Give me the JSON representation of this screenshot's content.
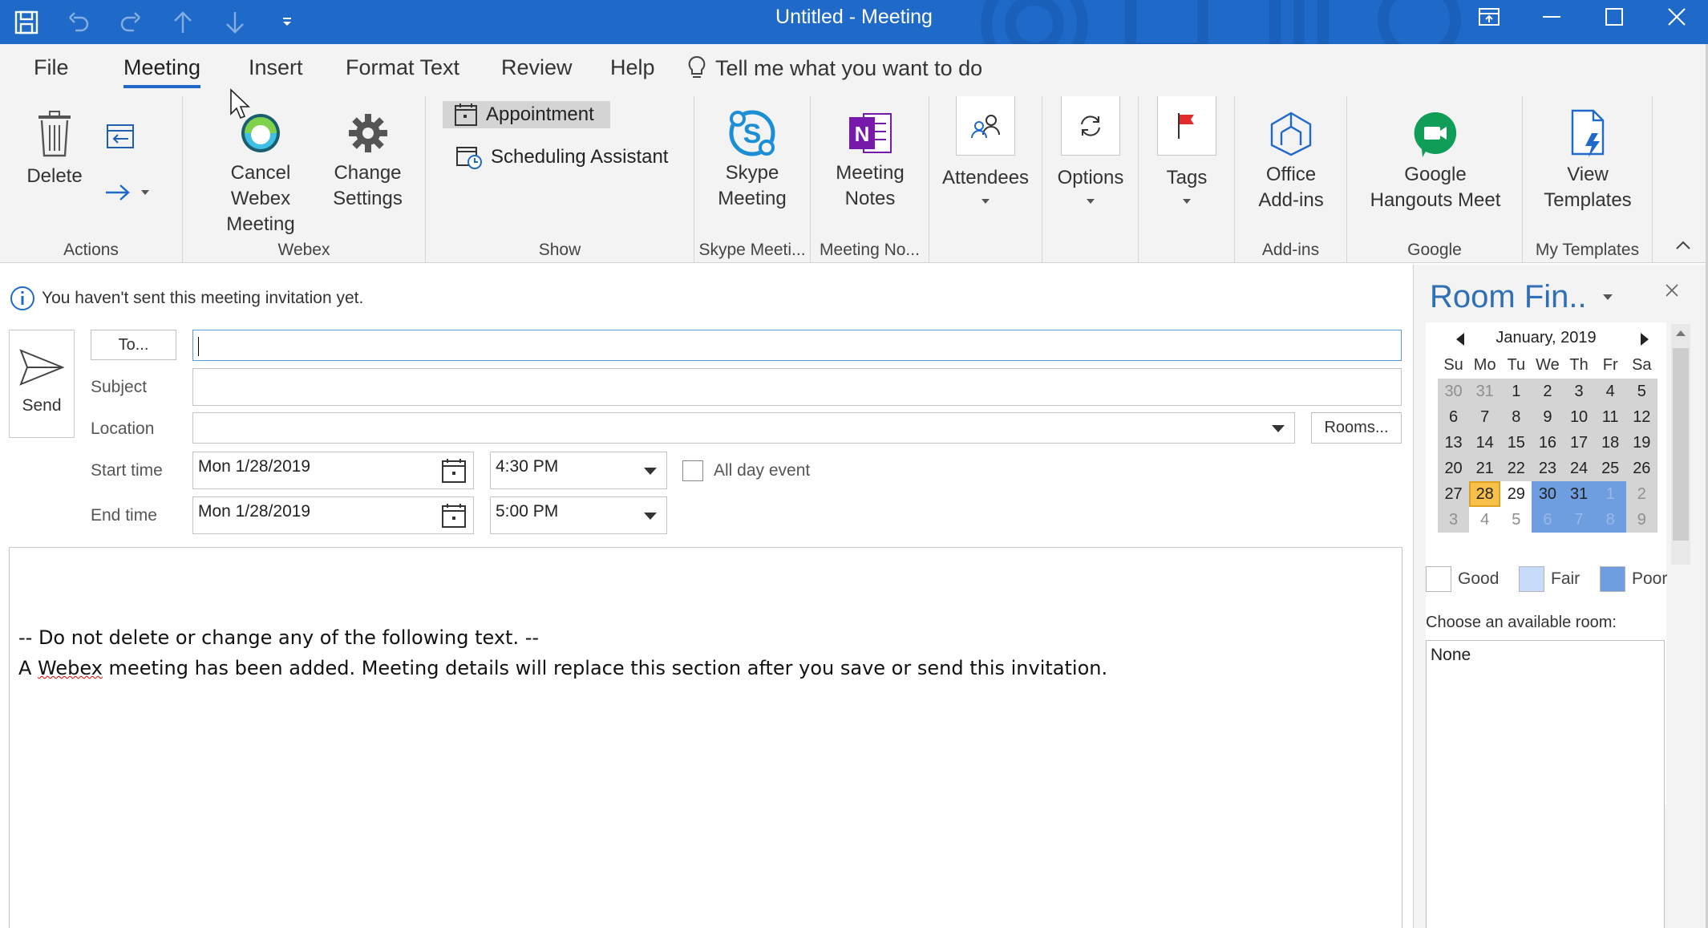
{
  "window": {
    "title": "Untitled  -  Meeting"
  },
  "tabs": [
    {
      "label": "File"
    },
    {
      "label": "Meeting"
    },
    {
      "label": "Insert"
    },
    {
      "label": "Format Text"
    },
    {
      "label": "Review"
    },
    {
      "label": "Help"
    }
  ],
  "tell_me": "Tell me what you want to do",
  "ribbon": {
    "actions": {
      "delete": "Delete",
      "group": "Actions"
    },
    "webex": {
      "cancel_line1": "Cancel Webex",
      "cancel_line2": "Meeting",
      "change_line1": "Change",
      "change_line2": "Settings",
      "group": "Webex"
    },
    "show": {
      "appointment": "Appointment",
      "scheduling": "Scheduling Assistant",
      "group": "Show"
    },
    "skype": {
      "line1": "Skype",
      "line2": "Meeting",
      "group": "Skype Meeti..."
    },
    "notes": {
      "line1": "Meeting",
      "line2": "Notes",
      "group": "Meeting No..."
    },
    "attendees": "Attendees",
    "options": "Options",
    "tags": "Tags",
    "addins": {
      "line1": "Office",
      "line2": "Add-ins",
      "group": "Add-ins"
    },
    "google": {
      "line1": "Google",
      "line2": "Hangouts Meet",
      "group": "Google"
    },
    "templates": {
      "line1": "View",
      "line2": "Templates",
      "group": "My Templates"
    }
  },
  "form": {
    "info": "You haven't sent this meeting invitation yet.",
    "send": "Send",
    "to_button": "To...",
    "subject_label": "Subject",
    "location_label": "Location",
    "rooms_button": "Rooms...",
    "start_label": "Start time",
    "end_label": "End time",
    "start_date": "Mon 1/28/2019",
    "start_time": "4:30 PM",
    "end_date": "Mon 1/28/2019",
    "end_time": "5:00 PM",
    "all_day": "All day event",
    "body_line1": "-- Do not delete or change any of the following text. --",
    "body_line2_a": "A ",
    "body_line2_b": "Webex",
    "body_line2_c": " meeting has been added. Meeting details will replace this section after you save or send this invitation."
  },
  "room_finder": {
    "title": "Room Fin..",
    "month": "January, 2019",
    "dows": [
      "Su",
      "Mo",
      "Tu",
      "We",
      "Th",
      "Fr",
      "Sa"
    ],
    "weeks": [
      [
        "30",
        "31",
        "1",
        "2",
        "3",
        "4",
        "5"
      ],
      [
        "6",
        "7",
        "8",
        "9",
        "10",
        "11",
        "12"
      ],
      [
        "13",
        "14",
        "15",
        "16",
        "17",
        "18",
        "19"
      ],
      [
        "20",
        "21",
        "22",
        "23",
        "24",
        "25",
        "26"
      ],
      [
        "27",
        "28",
        "29",
        "30",
        "31",
        "1",
        "2"
      ],
      [
        "3",
        "4",
        "5",
        "6",
        "7",
        "8",
        "9"
      ]
    ],
    "legend_good": "Good",
    "legend_fair": "Fair",
    "legend_poor": "Poor",
    "choose_label": "Choose an available room:",
    "room_none": "None"
  },
  "colors": {
    "titlebar": "#1f6ac9",
    "today": "#f7c04a",
    "poor": "#6e9de0",
    "fair": "#c6dcfa",
    "good": "#ffffff"
  }
}
